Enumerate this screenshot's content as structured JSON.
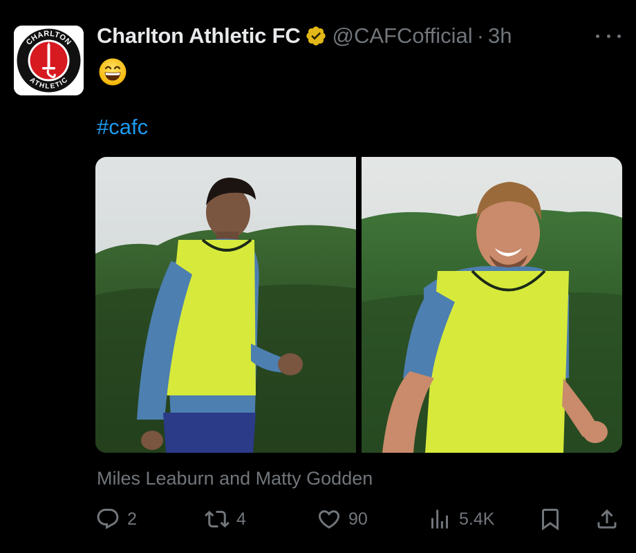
{
  "tweet": {
    "author_name": "Charlton Athletic FC",
    "handle": "@CAFCofficial",
    "separator": "·",
    "time": "3h",
    "emoji": "😄",
    "hashtag": "#cafc",
    "caption": "Miles Leaburn and Matty Godden",
    "avatar": {
      "ring_text_top": "CHARLTON",
      "ring_text_bottom": "ATHLETIC"
    },
    "icons": {
      "verified": "verified-badge-icon",
      "more": "more-options-icon",
      "reply": "reply-icon",
      "retweet": "retweet-icon",
      "like": "heart-icon",
      "views": "views-icon",
      "bookmark": "bookmark-icon",
      "share": "share-icon"
    },
    "colors": {
      "background": "#000000",
      "text": "#e7e9ea",
      "muted": "#71767b",
      "link": "#1d9bf0",
      "verified": "#e2b719",
      "club_red": "#d71920"
    }
  },
  "actions": {
    "reply_count": "2",
    "retweet_count": "4",
    "like_count": "90",
    "views_count": "5.4K"
  }
}
